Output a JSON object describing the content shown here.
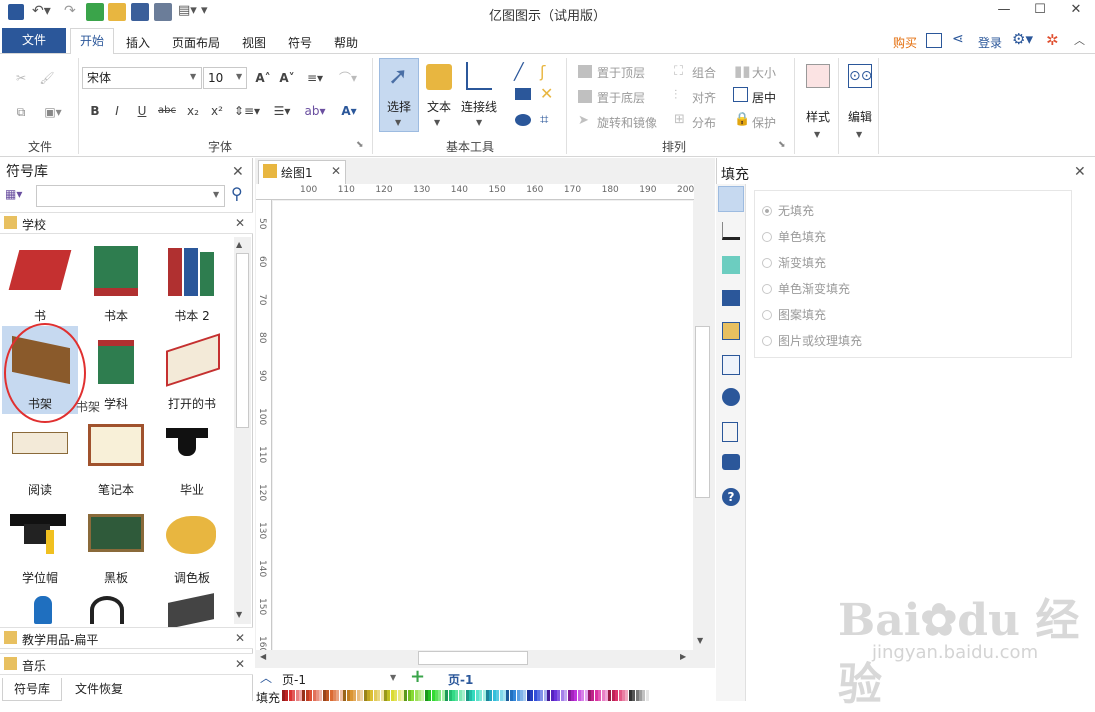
{
  "window": {
    "title": "亿图图示（试用版）",
    "minimize": "—",
    "maximize": "☐",
    "close": "✕"
  },
  "menu": {
    "file": "文件",
    "home": "开始",
    "insert": "插入",
    "page_layout": "页面布局",
    "view": "视图",
    "symbols": "符号",
    "help": "帮助",
    "buy": "购买",
    "login": "登录"
  },
  "ribbon": {
    "file_group": "文件",
    "font_group": "字体",
    "basic_tools_group": "基本工具",
    "arrange_group": "排列",
    "font_name": "宋体",
    "font_size": "10",
    "select": "选择",
    "text": "文本",
    "connector": "连接线",
    "bring_front": "置于顶层",
    "send_back": "置于底层",
    "rotate_mirror": "旋转和镜像",
    "group": "组合",
    "align": "对齐",
    "distribute": "分布",
    "size": "大小",
    "center": "居中",
    "protect": "保护",
    "style": "样式",
    "edit": "编辑"
  },
  "left_panel": {
    "title": "符号库",
    "search_placeholder": "",
    "category": "学校",
    "symbols": [
      "书",
      "书本",
      "书本 2",
      "书架",
      "学科",
      "打开的书",
      "阅读",
      "笔记本",
      "毕业",
      "学位帽",
      "黑板",
      "调色板"
    ],
    "tooltip": "书架",
    "category2": "教学用品-扁平",
    "category3": "音乐",
    "tab_library": "符号库",
    "tab_recovery": "文件恢复"
  },
  "canvas": {
    "doc_tab": "绘图1",
    "hruler": [
      "100",
      "110",
      "120",
      "130",
      "140",
      "150",
      "160",
      "170",
      "180",
      "190",
      "200"
    ],
    "vruler": [
      "50",
      "60",
      "70",
      "80",
      "90",
      "100",
      "110",
      "120",
      "130",
      "140",
      "150",
      "160"
    ],
    "page_select": "页-1",
    "page_tab": "页-1",
    "fill_label": "填充"
  },
  "right_panel": {
    "title": "填充",
    "options": [
      "无填充",
      "单色填充",
      "渐变填充",
      "单色渐变填充",
      "图案填充",
      "图片或纹理填充"
    ]
  },
  "colors": {
    "accent": "#2b579a",
    "buy": "#e36c09",
    "selection": "#c6d9f0",
    "circle": "#e03030"
  }
}
